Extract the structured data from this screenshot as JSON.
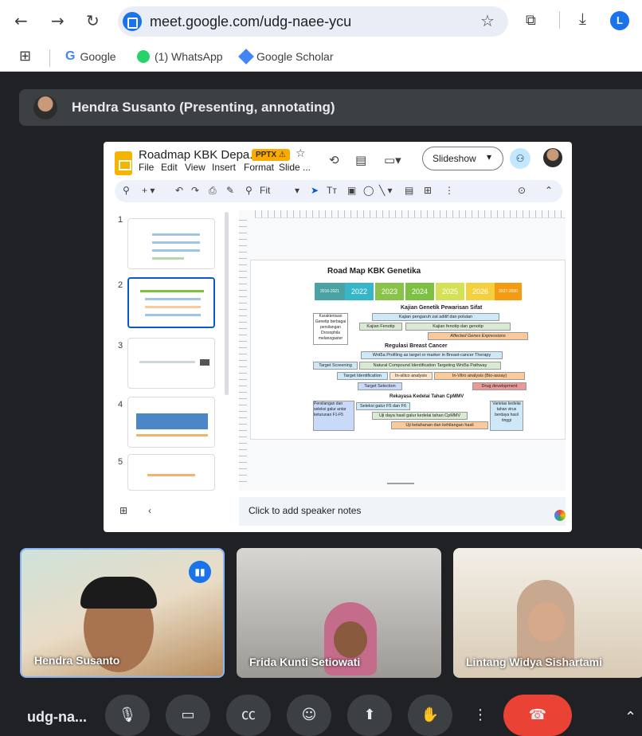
{
  "browser": {
    "url": "meet.google.com/udg-naee-ycu",
    "profile_initial": "L",
    "bookmarks": [
      "Google",
      "(1) WhatsApp",
      "Google Scholar"
    ]
  },
  "meet": {
    "presenter_label": "Hendra Susanto (Presenting, annotating)",
    "meeting_code": "udg-na...",
    "participants": [
      "Hendra Susanto",
      "Frida Kunti Setiowati",
      "Lintang Widya Sishartami"
    ]
  },
  "slides_app": {
    "doc_title": "Roadmap KBK Depa...",
    "badge": "PPTX",
    "menu": [
      "File",
      "Edit",
      "View",
      "Insert",
      "Format",
      "Slide",
      "..."
    ],
    "slideshow_label": "Slideshow",
    "zoom_label": "Fit",
    "slide_numbers": [
      "1",
      "2",
      "3",
      "4",
      "5"
    ],
    "speaker_notes_placeholder": "Click to add speaker notes"
  },
  "slide": {
    "title": "Road Map KBK Genetika",
    "years": [
      "2016-2021",
      "2022",
      "2023",
      "2024",
      "2025",
      "2026",
      "2027-2030"
    ],
    "year_colors": [
      "#4aa3a2",
      "#37b6c9",
      "#8bc34a",
      "#7cc142",
      "#d4e157",
      "#f4d03f",
      "#f39c12"
    ],
    "section1_title": "Kajian Genetik Pewarisan Sifat",
    "section1": [
      "Karakterisasi Genetip berbagai persilangan Drosophila melanogaster",
      "Kajian pengaruh zat aditif dan polutan",
      "Kajian Fenotip",
      "Kajian fenotip dan genotip",
      "Affected Genes Expressions"
    ],
    "section2_title": "Regulasi Breast Cancer",
    "section2": [
      "Wnt5a Profiling as target or marker in Breast-cancer Therapy",
      "Target Screening",
      "Natural Compound Identification Targeting Wnt5a Pathway",
      "Target Identification",
      "In-silico analysis",
      "In-Vitro analysis (Bio-assay)",
      "Target Selection",
      "Drug development"
    ],
    "section3_title": "Rekayasa Kedelai Tahan CpMMV",
    "section3": [
      "Persilangan dan seleksi galur antar keturunan F1-F5",
      "Seleksi galur F5 dan F6",
      "Uji daya hasil galur kedelai tahan CpMMV",
      "Uji ketahanan dan kehilangan hasil",
      "Varietas kedelai tahan virus berdaya hasil tinggi"
    ]
  }
}
